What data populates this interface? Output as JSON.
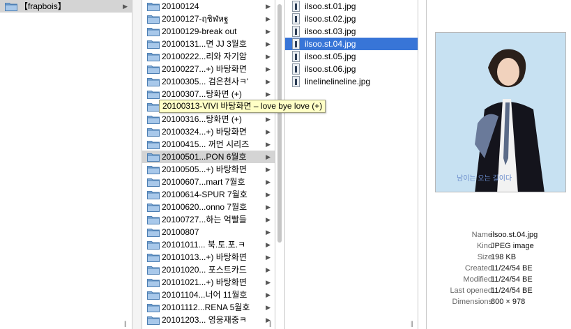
{
  "column1": {
    "items": [
      {
        "label": "【frapbois】",
        "selected": true
      }
    ]
  },
  "column2": {
    "items": [
      {
        "label": "20100124"
      },
      {
        "label": "20100127-ฤชิฬหฐ"
      },
      {
        "label": "20100129-break out"
      },
      {
        "label": "20100131...면 JJ 3월호"
      },
      {
        "label": "20100222...리와 자기암"
      },
      {
        "label": "20100227...+) 바탕화면"
      },
      {
        "label": "20100305... 검은천사ㅋ'"
      },
      {
        "label": "20100307...탕화면 (+)"
      },
      {
        "label": "20100313-VIVI 바탕화면 – love bye love (+)"
      },
      {
        "label": "20100316...탕화면 (+)"
      },
      {
        "label": "20100324...+) 바탕화면"
      },
      {
        "label": "20100415... 꺼먼 시리즈"
      },
      {
        "label": "20100501...PON 6월호",
        "selected": true
      },
      {
        "label": "20100505...+) 바탕화면"
      },
      {
        "label": "20100607...mart 7월호"
      },
      {
        "label": "20100614-SPUR 7월호"
      },
      {
        "label": "20100620...onno 7월호"
      },
      {
        "label": "20100727...하는 억빨들"
      },
      {
        "label": "20100807"
      },
      {
        "label": "20101011... 북.토.포.ㅋ"
      },
      {
        "label": "20101013...+) 바탕화면"
      },
      {
        "label": "20101020... 포스트카드"
      },
      {
        "label": "20101021...+) 바탕화면"
      },
      {
        "label": "20101104...너어 11월호"
      },
      {
        "label": "20101112...RENA 5월호"
      },
      {
        "label": "20101203... 영웅재중ㅋ"
      }
    ]
  },
  "tooltip": "20100313-VIVI 바탕화면 – love bye love (+)",
  "column3": {
    "items": [
      {
        "label": "ilsoo.st.01.jpg"
      },
      {
        "label": "ilsoo.st.02.jpg"
      },
      {
        "label": "ilsoo.st.03.jpg"
      },
      {
        "label": "ilsoo.st.04.jpg",
        "selected": true
      },
      {
        "label": "ilsoo.st.05.jpg"
      },
      {
        "label": "ilsoo.st.06.jpg"
      },
      {
        "label": "linelinelineline.jpg"
      }
    ]
  },
  "preview": {
    "caption": "남이는 오는 길이다"
  },
  "info": {
    "rows": [
      {
        "label": "Name",
        "value": "ilsoo.st.04.jpg"
      },
      {
        "label": "Kind",
        "value": "JPEG image"
      },
      {
        "label": "Size",
        "value": "198 KB"
      },
      {
        "label": "Created",
        "value": "11/24/54 BE"
      },
      {
        "label": "Modified",
        "value": "11/24/54 BE"
      },
      {
        "label": "Last opened",
        "value": "11/24/54 BE"
      },
      {
        "label": "Dimensions",
        "value": "800 × 978"
      }
    ]
  },
  "colors": {
    "selection_blue": "#3875d7",
    "selection_gray": "#d4d4d4",
    "folder": "#7fa9d6",
    "tooltip_bg": "#ffffc6"
  }
}
